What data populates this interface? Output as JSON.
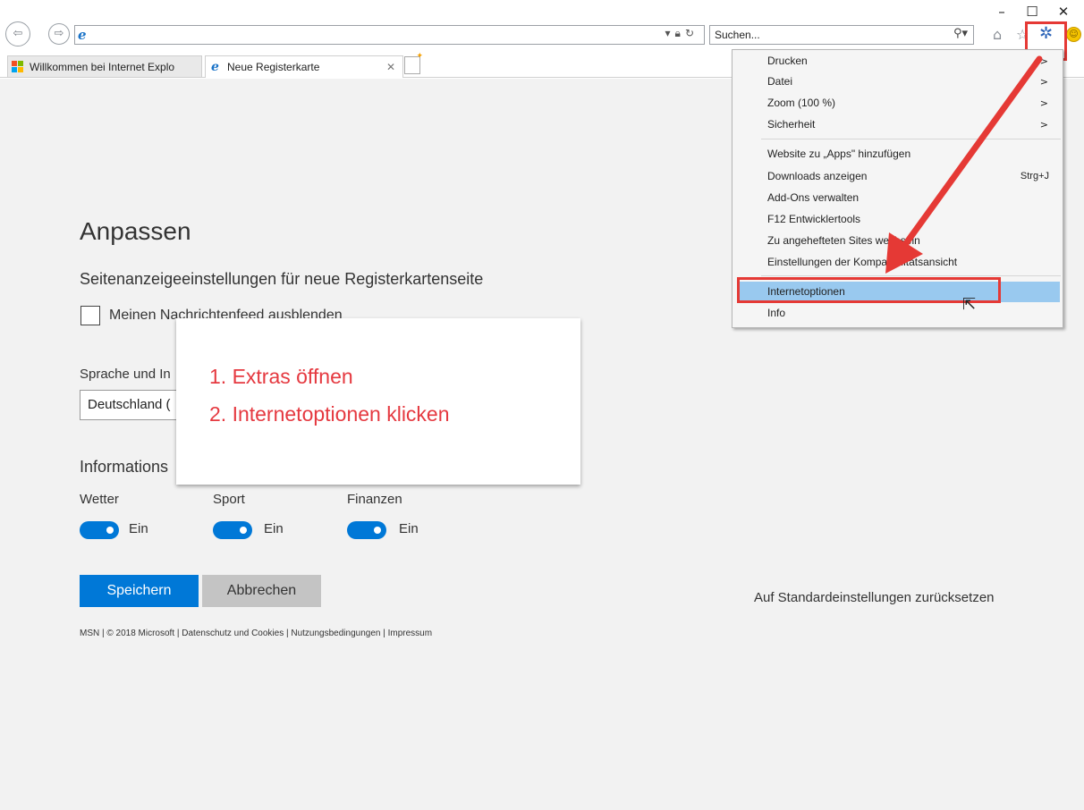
{
  "window": {
    "minimize_icon": "minimize-icon",
    "maximize_icon": "maximize-icon",
    "close_icon": "close-icon"
  },
  "toolbar": {
    "search_placeholder": "Suchen...",
    "icons": [
      "back-icon",
      "forward-icon",
      "ie-logo-icon",
      "lock-icon",
      "refresh-icon",
      "search-icon",
      "home-icon",
      "favorites-star-icon",
      "gear-icon",
      "smiley-icon"
    ]
  },
  "tabs": [
    {
      "label": "Willkommen bei Internet Explo"
    },
    {
      "label": "Neue Registerkarte"
    }
  ],
  "page": {
    "title": "Anpassen",
    "subtitle": "Seitenanzeigeeinstellungen für neue Registerkartenseite",
    "checkbox_label": "Meinen Nachrichtenfeed ausblenden",
    "language_label": "Sprache und In",
    "language_value": "Deutschland (",
    "info_label": "Informations",
    "toggles": [
      {
        "label": "Wetter",
        "state": "Ein",
        "on": true
      },
      {
        "label": "Sport",
        "state": "Ein",
        "on": true
      },
      {
        "label": "Finanzen",
        "state": "Ein",
        "on": true
      }
    ],
    "save_label": "Speichern",
    "cancel_label": "Abbrechen",
    "reset_label": "Auf Standardeinstellungen zurücksetzen",
    "footer": "MSN | © 2018 Microsoft | Datenschutz und Cookies | Nutzungsbedingungen | Impressum"
  },
  "callout": {
    "step1": "1. Extras öffnen",
    "step2": "2. Internetoptionen klicken"
  },
  "menu": {
    "items": [
      {
        "label": "Drucken",
        "arrow": ">"
      },
      {
        "label": "Datei",
        "arrow": ">"
      },
      {
        "label": "Zoom (100 %)",
        "arrow": ">"
      },
      {
        "label": "Sicherheit",
        "arrow": ">"
      },
      {
        "label": "Website zu „Apps\" hinzufügen"
      },
      {
        "label": "Downloads anzeigen",
        "shortcut": "Strg+J"
      },
      {
        "label": "Add-Ons verwalten"
      },
      {
        "label": "F12 Entwicklertools"
      },
      {
        "label": "Zu angehefteten Sites wechseln"
      },
      {
        "label": "Einstellungen der Kompatibilitätsansicht"
      },
      {
        "label": "Internetoptionen",
        "highlighted": true
      },
      {
        "label": "Info"
      }
    ]
  },
  "colors": {
    "accent": "#0078d7",
    "annotation": "#e53935",
    "menu_highlight": "#99c9ef"
  }
}
